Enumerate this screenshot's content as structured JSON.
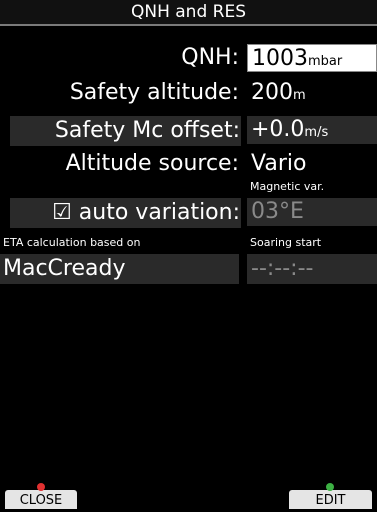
{
  "title": "QNH and RES",
  "fields": {
    "qnh": {
      "label": "QNH:",
      "value": "1003",
      "unit": "mbar"
    },
    "safety_altitude": {
      "label": "Safety altitude:",
      "value": "200",
      "unit": "m"
    },
    "safety_mc_offset": {
      "label": "Safety Mc offset:",
      "value": "+0.0",
      "unit": "m/s"
    },
    "altitude_source": {
      "label": "Altitude source:",
      "value": "Vario"
    }
  },
  "auto_variation": {
    "check": "☑",
    "label": "auto variation:"
  },
  "magnetic_var": {
    "label": "Magnetic var.",
    "value": "03°E"
  },
  "eta": {
    "label": "ETA calculation based on",
    "value": "MacCready"
  },
  "soaring_start": {
    "label": "Soaring start",
    "value": "--:--:--"
  },
  "buttons": {
    "close": "CLOSE",
    "edit": "EDIT"
  },
  "colors": {
    "close_mark": "#e03030",
    "edit_mark": "#3cb043"
  }
}
